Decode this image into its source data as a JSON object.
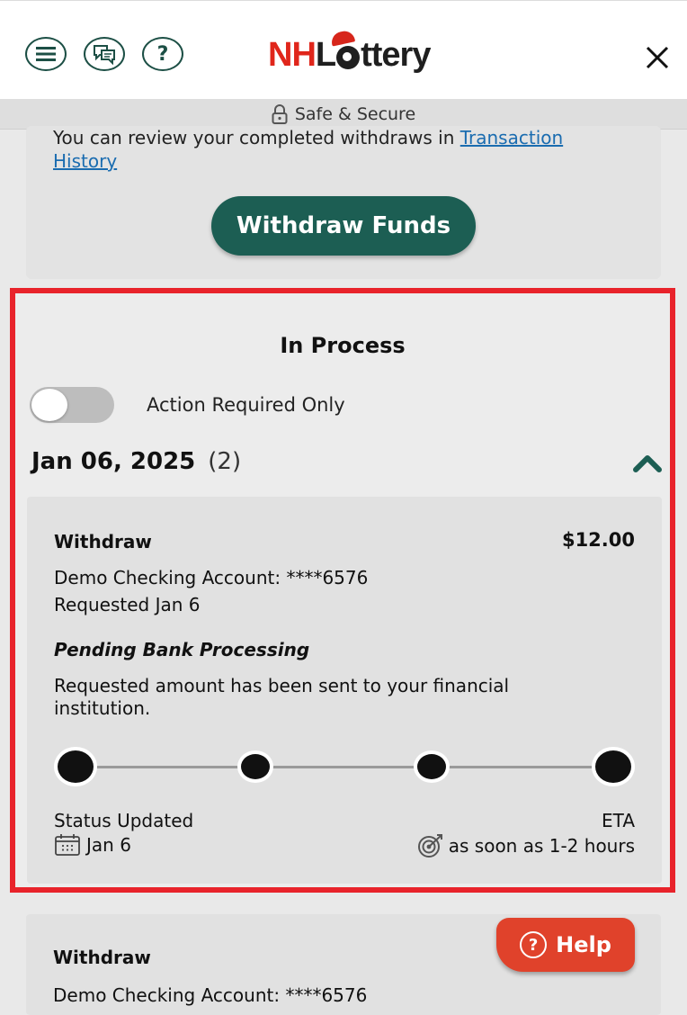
{
  "header": {
    "logo_nh": "NH",
    "logo_rest": "ttery",
    "logo_text": "NHLottery",
    "secure_text": "Safe & Secure",
    "icons": [
      "menu-icon",
      "chat-icon",
      "help-question-icon",
      "close-icon"
    ]
  },
  "info": {
    "text_prefix": "You can review your completed withdraws in ",
    "link_text": "Transaction History",
    "withdraw_button": "Withdraw Funds"
  },
  "in_process": {
    "title": "In Process",
    "toggle_label": "Action Required Only",
    "toggle_on": false,
    "date": "Jan 06, 2025",
    "count": "(2)",
    "transactions": [
      {
        "type": "Withdraw",
        "amount": "$12.00",
        "account": "Demo Checking Account: ****6576",
        "requested": "Requested Jan 6",
        "status": "Pending Bank Processing",
        "description": "Requested amount has been sent to your financial institution.",
        "progress_steps": 4,
        "status_updated_label": "Status Updated",
        "status_updated_date": "Jan 6",
        "eta_label": "ETA",
        "eta_value": "as soon as 1-2 hours"
      },
      {
        "type": "Withdraw",
        "account": "Demo Checking Account: ****6576"
      }
    ]
  },
  "help": {
    "label": "Help"
  },
  "colors": {
    "accent": "#1c5e53",
    "highlight_border": "#e8232b",
    "help": "#e0422b",
    "link": "#1a6cb0"
  }
}
